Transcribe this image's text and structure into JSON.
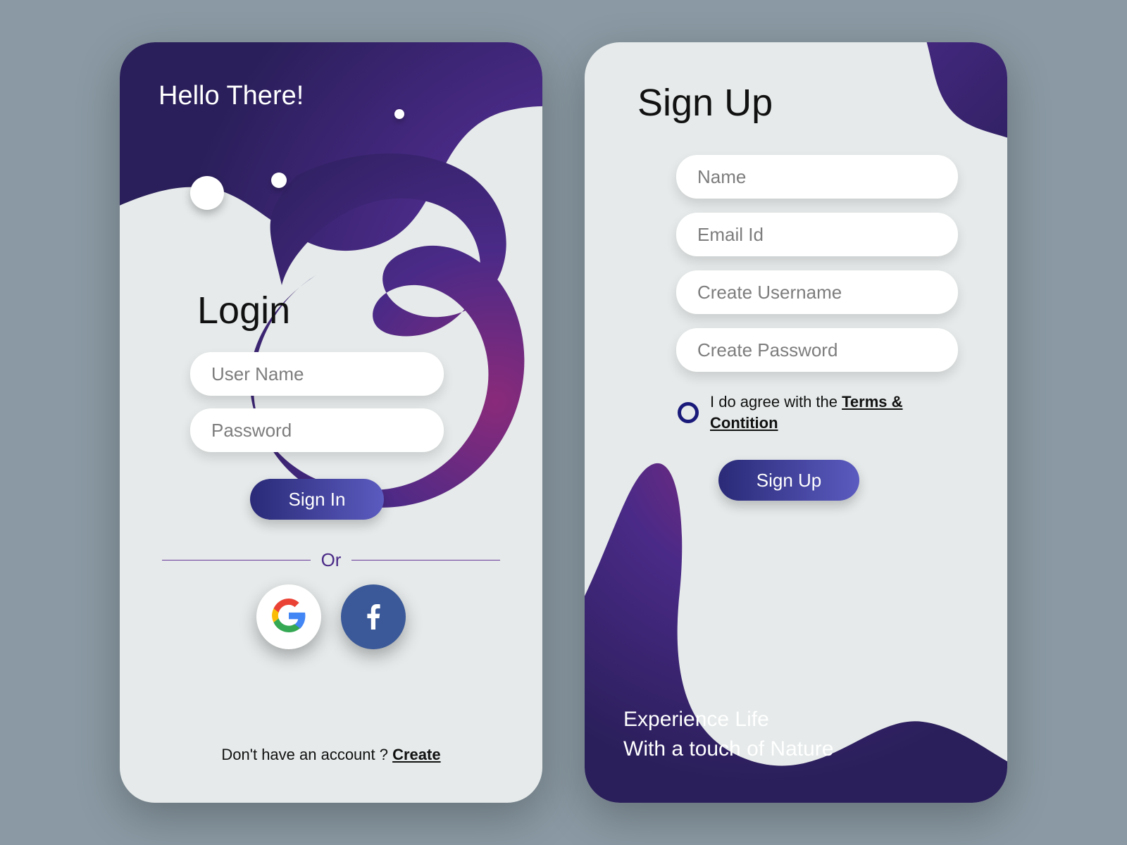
{
  "login": {
    "greeting": "Hello There!",
    "title": "Login",
    "username_placeholder": "User Name",
    "password_placeholder": "Password",
    "sign_in_label": "Sign In",
    "or_label": "Or",
    "footer_prefix": "Don't have an account ? ",
    "footer_link": "Create"
  },
  "signup": {
    "title": "Sign Up",
    "name_placeholder": "Name",
    "email_placeholder": "Email Id",
    "username_placeholder": "Create Username",
    "password_placeholder": "Create Password",
    "agree_prefix": "I do agree with the ",
    "agree_link": "Terms & Contition",
    "sign_up_label": "Sign Up",
    "tagline_line1": "Experience Life",
    "tagline_line2": "With a touch of Nature"
  }
}
